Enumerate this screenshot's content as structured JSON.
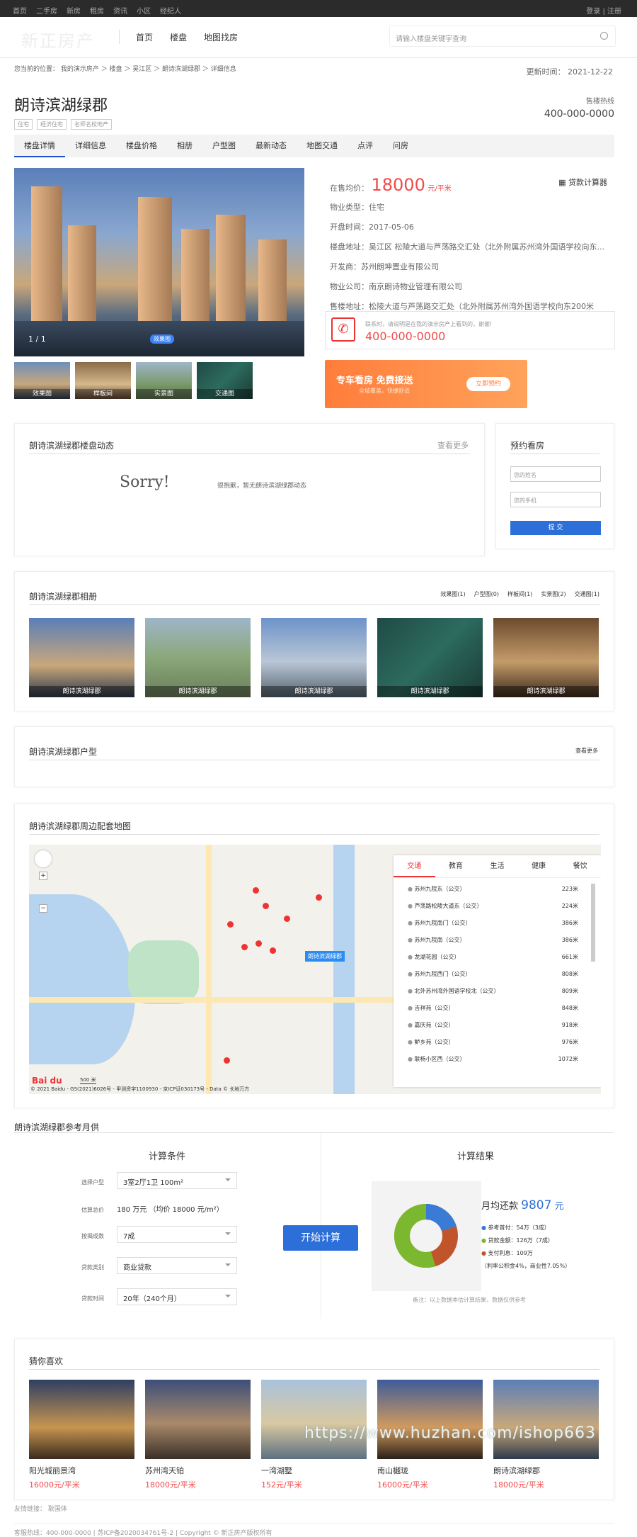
{
  "topbar": {
    "links": [
      "首页",
      "二手房",
      "新房",
      "租房",
      "资讯",
      "小区",
      "经纪人"
    ],
    "account": "登录 | 注册"
  },
  "header": {
    "logo": "新正房产",
    "nav": [
      "首页",
      "楼盘",
      "地图找房"
    ],
    "search_placeholder": "请输入楼盘关键字查询"
  },
  "breadcrumb": "您当前的位置： 我的演示房产 ＞ 楼盘 ＞ 吴江区 ＞ 朗诗滨湖绿郡 ＞ 详细信息",
  "updated": "更新时间： 2021-12-22",
  "title": "朗诗滨湖绿郡",
  "tags": [
    "住宅",
    "经济住宅",
    "名师名校地产"
  ],
  "hotline": {
    "label": "售楼热线",
    "number": "400-000-0000"
  },
  "tabs": [
    "楼盘详情",
    "详细信息",
    "楼盘价格",
    "相册",
    "户型图",
    "最新动态",
    "地图交通",
    "点评",
    "问房"
  ],
  "gallery": {
    "counter": "1 / 1",
    "badge": "效果图",
    "thumbs": [
      "效果图",
      "样板间",
      "实景图",
      "交通图"
    ]
  },
  "info": {
    "price_label": "在售均价：",
    "price": "18000",
    "price_unit": "元/平米",
    "calc": "贷款计算器",
    "rows": [
      {
        "k": "物业类型：",
        "v": "住宅"
      },
      {
        "k": "开盘时间：",
        "v": "2017-05-06"
      },
      {
        "k": "楼盘地址：",
        "v": "吴江区 松陵大道与芦荡路交汇处（北外附属苏州湾外国语学校向东..."
      },
      {
        "k": "开发商：",
        "v": "苏州朗坤置业有限公司"
      },
      {
        "k": "物业公司：",
        "v": "南京朗诗物业管理有限公司"
      },
      {
        "k": "售楼地址：",
        "v": "松陵大道与芦荡路交汇处（北外附属苏州湾外国语学校向东200米"
      }
    ]
  },
  "phone": {
    "tip": "联系时，请说明是在我的演示房产上看到的，谢谢!",
    "number": "400-000-0000"
  },
  "banner": {
    "title": "专车看房 免费接送",
    "sub": "全城覆盖，快捷舒适",
    "button": "立即预约"
  },
  "news": {
    "title": "朗诗滨湖绿郡楼盘动态",
    "more": "查看更多",
    "sorry": "Sorry!",
    "msg": "很抱歉，暂无朗诗滨湖绿郡动态"
  },
  "booking": {
    "title": "预约看房",
    "name_ph": "您的姓名",
    "phone_ph": "您的手机",
    "submit": "提 交"
  },
  "album": {
    "title": "朗诗滨湖绿郡相册",
    "tabs": [
      "效果图(1)",
      "户型图(0)",
      "样板间(1)",
      "实景图(2)",
      "交通图(1)"
    ],
    "photos": [
      "朗诗滨湖绿郡",
      "朗诗滨湖绿郡",
      "朗诗滨湖绿郡",
      "朗诗滨湖绿郡",
      "朗诗滨湖绿郡"
    ]
  },
  "layout": {
    "title": "朗诗滨湖绿郡户型",
    "more": "查看更多"
  },
  "mapsec": {
    "title": "朗诗滨湖绿郡周边配套地图",
    "label": "朗诗滨湖绿郡",
    "tabs": [
      "交通",
      "教育",
      "生活",
      "健康",
      "餐饮"
    ],
    "items": [
      {
        "n": "苏州九院东（公交）",
        "d": "223米"
      },
      {
        "n": "芦荡路松陵大道东（公交）",
        "d": "224米"
      },
      {
        "n": "苏州九院南门（公交）",
        "d": "386米"
      },
      {
        "n": "苏州九院南（公交）",
        "d": "386米"
      },
      {
        "n": "龙湖花园（公交）",
        "d": "661米"
      },
      {
        "n": "苏州九院西门（公交）",
        "d": "808米"
      },
      {
        "n": "北外苏州湾外国语学校北（公交）",
        "d": "809米"
      },
      {
        "n": "吉祥苑（公交）",
        "d": "848米"
      },
      {
        "n": "嘉庆苑（公交）",
        "d": "918米"
      },
      {
        "n": "鲈乡苑（公交）",
        "d": "976米"
      },
      {
        "n": "联杨小区西（公交）",
        "d": "1072米"
      }
    ],
    "copyright": "© 2021 Baidu - GS(2021)6026号 - 甲测资字1100930 - 京ICP证030173号 - Data © 长地万方",
    "scale": "500 米"
  },
  "loan": {
    "title": "朗诗滨湖绿郡参考月供",
    "cond": "计算条件",
    "result": "计算结果",
    "fields": [
      {
        "k": "选择户型",
        "v": "3室2厅1卫 100m²"
      },
      {
        "k": "估算总价",
        "v": "180 万元 （均价 18000 元/m²）"
      },
      {
        "k": "按揭成数",
        "v": "7成"
      },
      {
        "k": "贷款类别",
        "v": "商业贷款"
      },
      {
        "k": "贷款时间",
        "v": "20年（240个月）"
      }
    ],
    "button": "开始计算",
    "monthly_label": "月均还款",
    "monthly": "9807",
    "monthly_unit": "元",
    "legend": [
      {
        "t": "参考首付：54万（3成）",
        "c": "#3a7bd5"
      },
      {
        "t": "贷款金额：126万（7成）",
        "c": "#7cb82f"
      },
      {
        "t": "支付利息：109万",
        "c": "#c0552b"
      }
    ],
    "rate": "（利率公积金4%，商业性7.05%）",
    "note": "备注：以上数据本估计算结果，数据仅供参考"
  },
  "guess": {
    "title": "猜你喜欢",
    "items": [
      {
        "n": "阳光城丽景湾",
        "p": "16000元/平米"
      },
      {
        "n": "苏州湾天铂",
        "p": "18000元/平米"
      },
      {
        "n": "一湾湖墅",
        "p": "152元/平米"
      },
      {
        "n": "南山樾珑",
        "p": "16000元/平米"
      },
      {
        "n": "朗诗滨湖绿郡",
        "p": "18000元/平米"
      }
    ]
  },
  "watermark": "https://www.huzhan.com/ishop663",
  "footer": {
    "links": "友情链接：  耿国体",
    "bottom": "客服热线：400-000-0000 | 苏ICP备2020034761号-2 | Copyright © 新正房产版权所有"
  }
}
